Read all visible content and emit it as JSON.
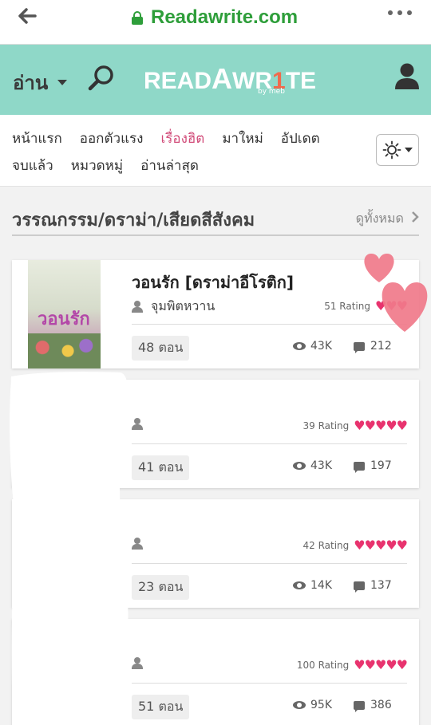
{
  "browser": {
    "url": "Readawrite.com",
    "back_icon": "back-arrow-icon",
    "menu_icon": "kebab-menu-icon"
  },
  "header": {
    "read_label": "อ่าน",
    "logo_pre": "READ",
    "logo_a": "A",
    "logo_wr": "WR",
    "logo_1": "1",
    "logo_te": "TE",
    "logo_by": "by meb",
    "bg_color": "#8fd8c8"
  },
  "nav": {
    "row1": [
      "หน้าแรก",
      "ออกตัวแรง",
      "เรื่องฮิต",
      "มาใหม่",
      "อัปเดต"
    ],
    "row2": [
      "จบแล้ว",
      "หมวดหมู่",
      "อ่านล่าสุด"
    ],
    "active": "เรื่องฮิต",
    "active_color": "#d14a78"
  },
  "section": {
    "title": "วรรณกรรม/ดราม่า/เสียดสีสังคม",
    "see_all": "ดูทั้งหมด"
  },
  "cards": [
    {
      "title": "วอนรัก [ดราม่าอีโรติก]",
      "author": "จุมพิตหวาน",
      "rating": "51 Rating",
      "hearts": "♥♥♥",
      "chapters": "48 ตอน",
      "views": "43K",
      "comments": "212",
      "cover_text": "วอนรัก"
    },
    {
      "title": "",
      "author": "",
      "rating": "39 Rating",
      "hearts": "♥♥♥♥♥",
      "chapters": "41 ตอน",
      "views": "43K",
      "comments": "197"
    },
    {
      "title": "",
      "author": "",
      "rating": "42 Rating",
      "hearts": "♥♥♥♥♥",
      "chapters": "23 ตอน",
      "views": "14K",
      "comments": "137"
    },
    {
      "title": "",
      "author": "",
      "rating": "100 Rating",
      "hearts": "♥♥♥♥♥",
      "chapters": "51 ตอน",
      "views": "95K",
      "comments": "386"
    }
  ],
  "colors": {
    "heart": "#e8336e",
    "decor_heart": "#f07a8a",
    "url_green": "#2e9e3a"
  }
}
